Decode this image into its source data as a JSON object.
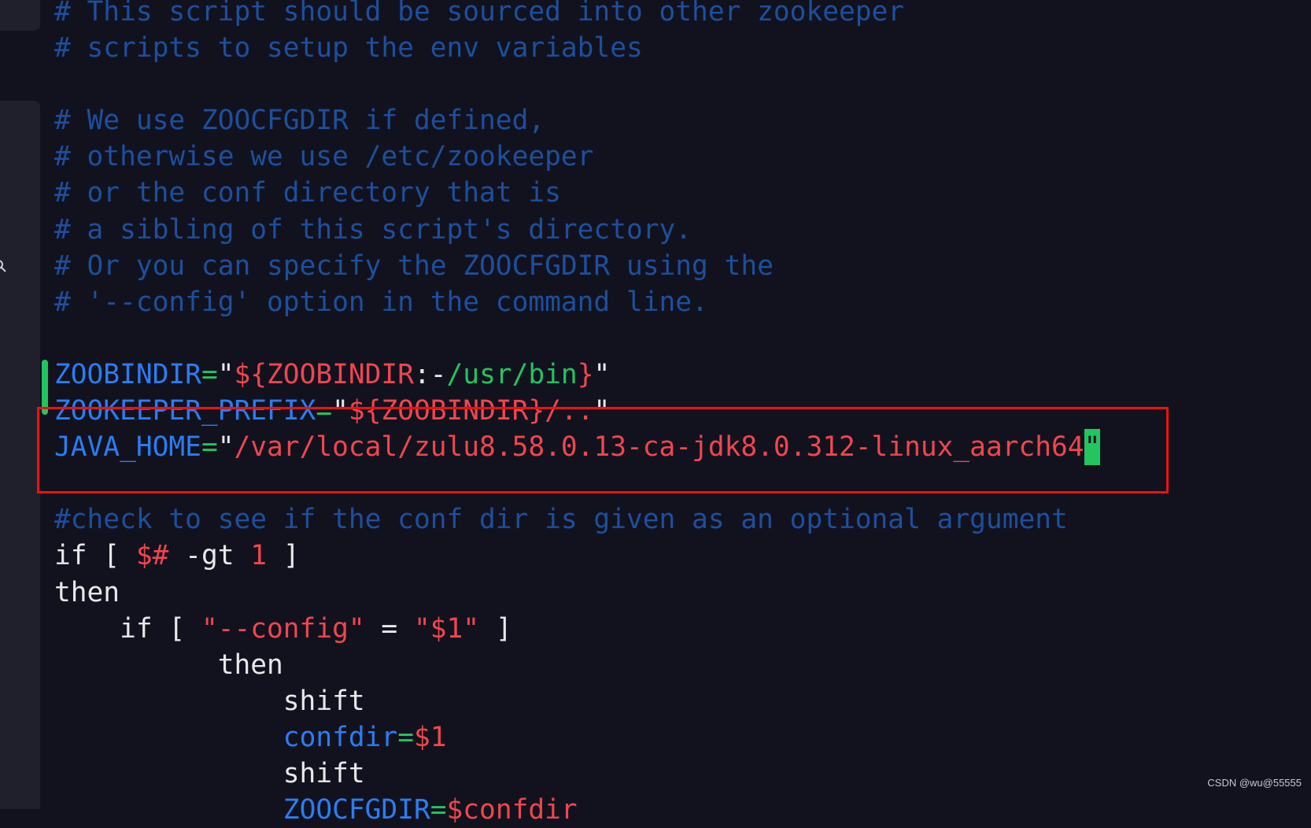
{
  "editor": {
    "colors": {
      "background": "#12121f",
      "comment": "#1d4f9c",
      "variable": "#2b7df2",
      "string": "#f0464e",
      "operator": "#22c55e",
      "text": "#e8e8ea",
      "highlight_box": "#f00f0f",
      "cursor": "#22c55e"
    },
    "lines": [
      [
        [
          "# This script should be sourced into other zookeeper",
          "c"
        ]
      ],
      [
        [
          "# scripts to setup the env variables",
          "c"
        ]
      ],
      [],
      [
        [
          "# We use ZOOCFGDIR if defined,",
          "c"
        ]
      ],
      [
        [
          "# otherwise we use /etc/zookeeper",
          "c"
        ]
      ],
      [
        [
          "# or the conf directory that is",
          "c"
        ]
      ],
      [
        [
          "# a sibling of this script's directory.",
          "c"
        ]
      ],
      [
        [
          "# Or you can specify the ZOOCFGDIR using the",
          "c"
        ]
      ],
      [
        [
          "# '--config' option in the command line.",
          "c"
        ]
      ],
      [],
      [
        [
          "ZOOBINDIR",
          "v"
        ],
        [
          "=",
          "g"
        ],
        [
          "\"",
          "w"
        ],
        [
          "${ZOOBINDIR",
          "r"
        ],
        [
          ":-",
          "w"
        ],
        [
          "/usr/bin",
          "g"
        ],
        [
          "}",
          "r"
        ],
        [
          "\"",
          "w"
        ]
      ],
      [
        [
          "ZOOKEEPER_PREFIX",
          "v"
        ],
        [
          "=",
          "g"
        ],
        [
          "\"",
          "w"
        ],
        [
          "${ZOOBINDIR}/..",
          "r"
        ],
        [
          "\"",
          "w"
        ]
      ],
      [
        [
          "JAVA_HOME",
          "v"
        ],
        [
          "=",
          "g"
        ],
        [
          "\"",
          "w"
        ],
        [
          "/var/local/zulu8.58.0.13-ca-jdk8.0.312-linux_aarch64",
          "r"
        ],
        [
          "\"",
          "cursor"
        ]
      ],
      [],
      [
        [
          "#check to see if the conf dir is given as an optional argument",
          "c"
        ]
      ],
      [
        [
          "if [ ",
          "w"
        ],
        [
          "$#",
          "r"
        ],
        [
          " -gt ",
          "w"
        ],
        [
          "1",
          "r"
        ],
        [
          " ]",
          "w"
        ]
      ],
      [
        [
          "then",
          "w"
        ]
      ],
      [
        [
          "    if [ ",
          "w"
        ],
        [
          "\"--config\"",
          "r"
        ],
        [
          " = ",
          "w"
        ],
        [
          "\"$1\"",
          "r"
        ],
        [
          " ]",
          "w"
        ]
      ],
      [
        [
          "          then",
          "w"
        ]
      ],
      [
        [
          "              shift",
          "w"
        ]
      ],
      [
        [
          "              ",
          "w"
        ],
        [
          "confdir",
          "v"
        ],
        [
          "=",
          "g"
        ],
        [
          "$1",
          "r"
        ]
      ],
      [
        [
          "              shift",
          "w"
        ]
      ],
      [
        [
          "              ",
          "w"
        ],
        [
          "ZOOCFGDIR",
          "v"
        ],
        [
          "=",
          "g"
        ],
        [
          "$confdir",
          "r"
        ]
      ]
    ]
  },
  "watermark": "CSDN @wu@55555"
}
